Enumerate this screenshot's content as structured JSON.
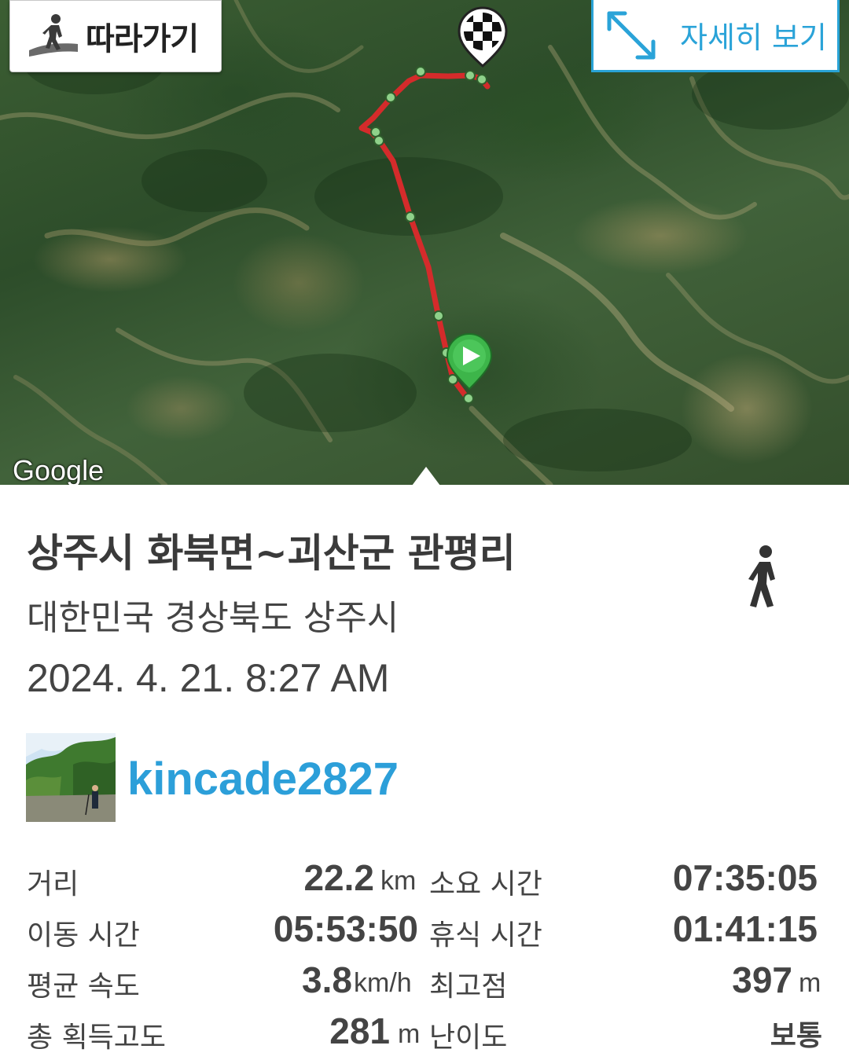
{
  "map": {
    "follow_label": "따라가기",
    "follow_icon": "hiker-follow-icon",
    "detail_label": "자세히 보기",
    "detail_icon": "expand-arrows-icon",
    "attribution": "Google",
    "start_marker_icon": "play-marker-icon",
    "finish_marker_icon": "checkered-flag-icon",
    "route_color": "#d42b2b",
    "waypoint_color": "#8fd18a"
  },
  "trip": {
    "title": "상주시 화북면~괴산군 관평리",
    "region": "대한민국 경상북도 상주시",
    "datetime": "2024. 4. 21. 8:27 AM",
    "activity_icon": "walking-person-icon"
  },
  "user": {
    "name": "kincade2827",
    "avatar_icon": "user-avatar-photo"
  },
  "stats": {
    "distance_label": "거리",
    "distance_value": "22.2",
    "distance_unit": "km",
    "total_time_label": "소요 시간",
    "total_time_value": "07:35:05",
    "moving_time_label": "이동 시간",
    "moving_time_value": "05:53:50",
    "rest_time_label": "휴식 시간",
    "rest_time_value": "01:41:15",
    "avg_speed_label": "평균 속도",
    "avg_speed_value": "3.8",
    "avg_speed_unit": "km/h",
    "max_elev_label": "최고점",
    "max_elev_value": "397",
    "max_elev_unit": "m",
    "total_gain_label": "총 획득고도",
    "total_gain_value": "281",
    "total_gain_unit": "m",
    "difficulty_label": "난이도",
    "difficulty_value": "보통"
  },
  "colors": {
    "accent": "#2c9fd9",
    "text": "#444444"
  }
}
